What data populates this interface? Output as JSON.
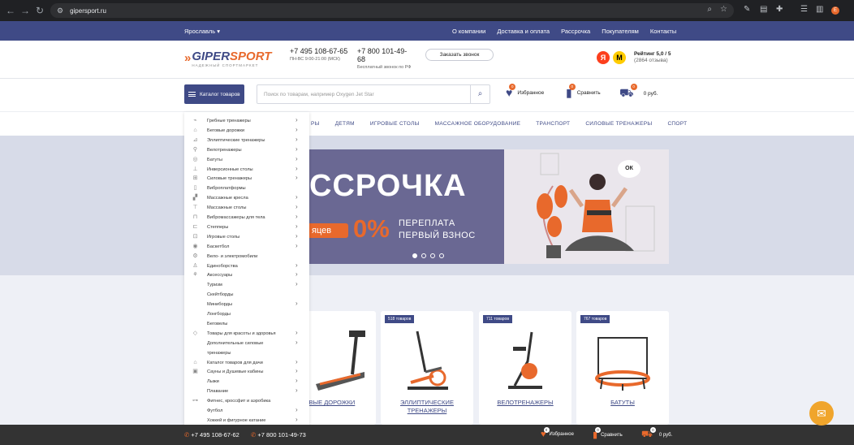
{
  "browser": {
    "url": "gipersport.ru",
    "profile_initial": "E"
  },
  "topbar": {
    "city": "Ярославль",
    "links": [
      "О компании",
      "Доставка и оплата",
      "Рассрочка",
      "Покупателям",
      "Контакты"
    ]
  },
  "header": {
    "logo_word_a": "GIPER",
    "logo_word_b": "SPORT",
    "logo_tag": "НАДЕЖНЫЙ СПОРТМАРКЕТ",
    "phone1": "+7 495 108-67-65",
    "phone1_sub": "ПН-ВС 9:00-21:00 (МСК)",
    "phone2": "+7 800 101-49-68",
    "phone2_sub": "Бесплатный звонок по РФ",
    "call_button": "Заказать звонок",
    "rating": "Рейтинг 5,0 / 5",
    "reviews": "(2864 отзыва)"
  },
  "search": {
    "catalog_button": "Каталог товаров",
    "placeholder": "Поиск по товарам, например Oxygen Jet Star",
    "favorites": "Избранное",
    "favorites_count": "0",
    "compare": "Сравнить",
    "compare_count": "0",
    "cart": "0 руб.",
    "cart_count": "0"
  },
  "catnav": [
    "РЫ",
    "ДЕТЯМ",
    "ИГРОВЫЕ СТОЛЫ",
    "МАССАЖНОЕ ОБОРУДОВАНИЕ",
    "ТРАНСПОРТ",
    "СИЛОВЫЕ ТРЕНАЖЕРЫ",
    "СПОРТ"
  ],
  "banner": {
    "title": "ССРОЧКА",
    "pill": "яцев",
    "percent": "0%",
    "line1": "ПЕРЕПЛАТА",
    "line2": "ПЕРВЫЙ ВЗНОС",
    "ok": "ОК"
  },
  "menu": [
    {
      "label": "Гребные тренажеры",
      "arrow": true,
      "icon": "⌁"
    },
    {
      "label": "Беговые дорожки",
      "arrow": true,
      "icon": "⌂"
    },
    {
      "label": "Эллиптические тренажеры",
      "arrow": true,
      "icon": "⊿"
    },
    {
      "label": "Велотренажеры",
      "arrow": true,
      "icon": "⚲"
    },
    {
      "label": "Батуты",
      "arrow": true,
      "icon": "◎"
    },
    {
      "label": "Инверсионные столы",
      "arrow": true,
      "icon": "⊥"
    },
    {
      "label": "Силовые тренажеры",
      "arrow": true,
      "icon": "⊞"
    },
    {
      "label": "Виброплатформы",
      "arrow": false,
      "icon": "▯"
    },
    {
      "label": "Массажные кресла",
      "arrow": true,
      "icon": "▞"
    },
    {
      "label": "Массажные столы",
      "arrow": true,
      "icon": "⊤"
    },
    {
      "label": "Вибромассажеры для тела",
      "arrow": true,
      "icon": "⊓"
    },
    {
      "label": "Степперы",
      "arrow": true,
      "icon": "⊏"
    },
    {
      "label": "Игровые столы",
      "arrow": true,
      "icon": "⊡"
    },
    {
      "label": "Баскетбол",
      "arrow": true,
      "icon": "◉"
    },
    {
      "label": "Вело- и электромобили",
      "arrow": false,
      "icon": "⚙"
    },
    {
      "label": "Единоборства",
      "arrow": true,
      "icon": "♙"
    },
    {
      "label": "Аксессуары",
      "arrow": true,
      "icon": "⚘"
    },
    {
      "label": "Туризм",
      "arrow": true,
      "icon": ""
    },
    {
      "label": "Скейтборды",
      "arrow": false,
      "icon": ""
    },
    {
      "label": "Миниборды",
      "arrow": true,
      "icon": ""
    },
    {
      "label": "Лонгборды",
      "arrow": false,
      "icon": ""
    },
    {
      "label": "Беговелы",
      "arrow": false,
      "icon": ""
    },
    {
      "label": "Товары для красоты и здоровья",
      "arrow": true,
      "icon": "◇"
    },
    {
      "label": "Дополнительные силовые",
      "arrow": true,
      "icon": ""
    },
    {
      "label": "тренажеры",
      "arrow": false,
      "icon": ""
    },
    {
      "label": "Каталог товаров для дачи",
      "arrow": true,
      "icon": "⌂"
    },
    {
      "label": "Сауны и Душевые кабины",
      "arrow": true,
      "icon": "▣"
    },
    {
      "label": "Лыжи",
      "arrow": true,
      "icon": ""
    },
    {
      "label": "Плавание",
      "arrow": true,
      "icon": ""
    },
    {
      "label": "Фитнес, кроссфит и аэробика",
      "arrow": false,
      "icon": "⊶"
    },
    {
      "label": "Футбол",
      "arrow": true,
      "icon": ""
    },
    {
      "label": "Хоккей и фигурное катание",
      "arrow": true,
      "icon": ""
    }
  ],
  "products": [
    {
      "count": "",
      "name": "ОВЫЕ ДОРОЖКИ"
    },
    {
      "count": "518 товаров",
      "name": "ЭЛЛИПТИЧЕСКИЕ ТРЕНАЖЕРЫ"
    },
    {
      "count": "711 товаров",
      "name": "ВЕЛОТРЕНАЖЕРЫ"
    },
    {
      "count": "767 товаров",
      "name": "БАТУТЫ"
    }
  ],
  "bottom": {
    "phone1": "+7 495 108-67-62",
    "phone2": "+7 800 101-49-73",
    "favorites": "Избранное",
    "compare": "Сравнить",
    "cart": "0 руб.",
    "count": "0"
  },
  "colors": {
    "brand": "#3f4a86",
    "accent": "#e8692c"
  }
}
